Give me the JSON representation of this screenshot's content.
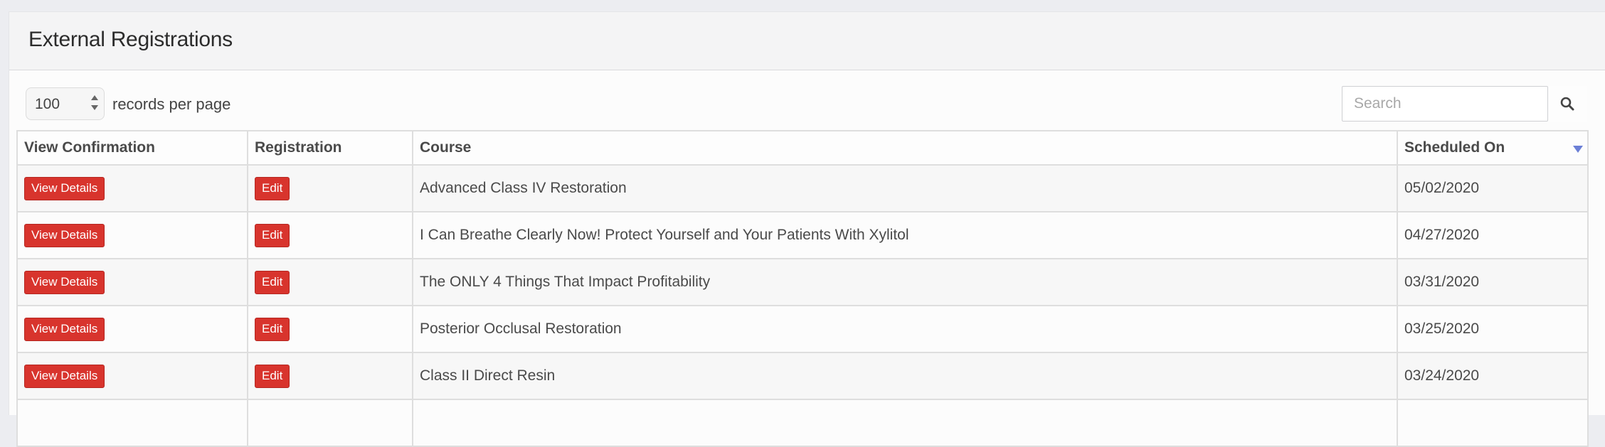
{
  "panel": {
    "title": "External Registrations"
  },
  "controls": {
    "page_size": "100",
    "page_size_label": "records per page",
    "search_placeholder": "Search",
    "search_icon": "search-icon"
  },
  "table": {
    "headers": [
      "View Confirmation",
      "Registration",
      "Course",
      "Scheduled On"
    ],
    "sort": {
      "column": "Scheduled On",
      "direction": "descending"
    },
    "rows": [
      {
        "view_label": "View Details",
        "edit_label": "Edit",
        "course": "Advanced Class IV Restoration",
        "scheduled_on": "05/02/2020"
      },
      {
        "view_label": "View Details",
        "edit_label": "Edit",
        "course": "I Can Breathe Clearly Now! Protect Yourself and Your Patients With Xylitol",
        "scheduled_on": "04/27/2020"
      },
      {
        "view_label": "View Details",
        "edit_label": "Edit",
        "course": "The ONLY 4 Things That Impact Profitability",
        "scheduled_on": "03/31/2020"
      },
      {
        "view_label": "View Details",
        "edit_label": "Edit",
        "course": "Posterior Occlusal Restoration",
        "scheduled_on": "03/25/2020"
      },
      {
        "view_label": "View Details",
        "edit_label": "Edit",
        "course": "Class II Direct Resin",
        "scheduled_on": "03/24/2020"
      },
      {
        "view_label": "",
        "edit_label": "",
        "course": "",
        "scheduled_on": ""
      }
    ]
  },
  "colors": {
    "button_red": "#d8342d",
    "sort_indicator": "#6b7fd6",
    "page_background": "#ecedf1"
  }
}
